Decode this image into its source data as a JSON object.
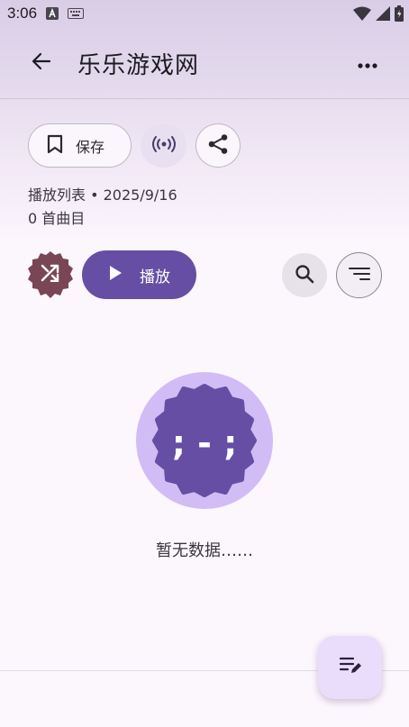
{
  "status_bar": {
    "time": "3:06",
    "left_icons": [
      "accessibility-a-icon",
      "keyboard-icon"
    ],
    "right_icons": [
      "wifi-icon",
      "signal-icon",
      "battery-icon"
    ]
  },
  "app_bar": {
    "title": "乐乐游戏网",
    "back_icon": "arrow-back-icon",
    "more_icon": "more-horiz-icon"
  },
  "actions": {
    "save_label": "保存",
    "save_icon": "bookmark-icon",
    "radio_icon": "radio-broadcast-icon",
    "share_icon": "share-icon"
  },
  "meta": {
    "line1": "播放列表 • 2025/9/16",
    "line2": "0 首曲目"
  },
  "controls": {
    "shuffle_icon": "shuffle-icon",
    "play_label": "播放",
    "play_icon": "play-icon",
    "search_icon": "search-icon",
    "sort_icon": "sort-icon"
  },
  "empty_state": {
    "face": "; - ;",
    "message": "暂无数据……"
  },
  "fab": {
    "icon": "edit-list-icon"
  },
  "colors": {
    "primary": "#654ea3",
    "primary_container": "#d1bcf5",
    "shuffle_bg": "#7a4656",
    "fab_bg": "#e9ddfb"
  }
}
